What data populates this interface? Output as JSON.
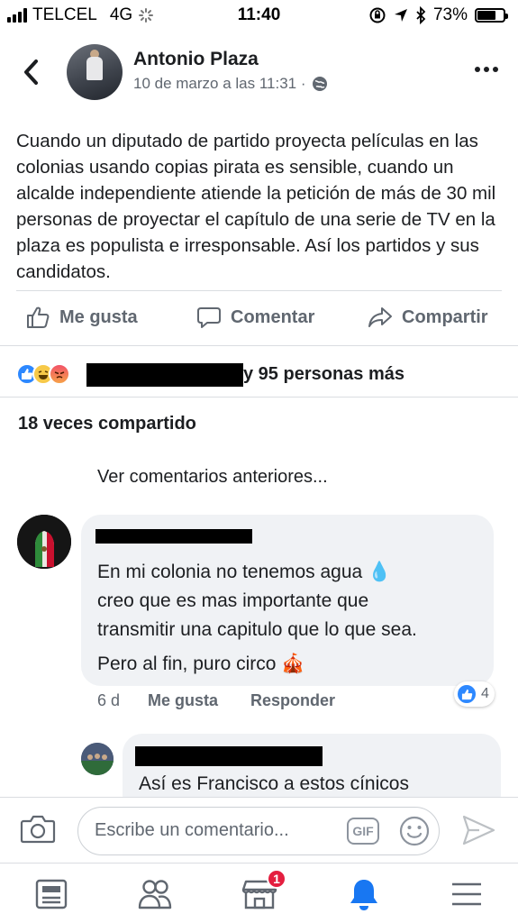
{
  "status_bar": {
    "carrier": "TELCEL",
    "network": "4G",
    "time": "11:40",
    "battery_percent": "73%",
    "battery_level": 0.73
  },
  "post": {
    "author": "Antonio Plaza",
    "date": "10 de marzo a las 11:31 ·",
    "privacy_icon": "globe-icon",
    "text": "Cuando un diputado de partido proyecta películas en las colonias usando copias pirata es sensible, cuando un alcalde independiente atiende la petición de más de 30 mil personas de proyectar el capítulo de una serie de TV en la plaza es populista e irresponsable. Así los partidos y sus candidatos."
  },
  "actions": {
    "like": "Me gusta",
    "comment": "Comentar",
    "share": "Compartir"
  },
  "reactions": {
    "others_text": "y 95 personas más",
    "icons": [
      "like-reaction-icon",
      "haha-reaction-icon",
      "angry-reaction-icon"
    ]
  },
  "shares": "18 veces compartido",
  "view_previous": "Ver comentarios anteriores...",
  "comments": [
    {
      "text_lines": [
        "En mi colonia no tenemos agua 💧",
        "creo que es mas importante que",
        "transmitir una capitulo que lo que sea."
      ],
      "text_line4": "Pero al fin, puro circo 🎪",
      "time": "6 d",
      "like_label": "Me gusta",
      "reply_label": "Responder",
      "like_count": "4"
    },
    {
      "text": "Así es Francisco a estos cínicos"
    }
  ],
  "composer": {
    "placeholder": "Escribe un comentario...",
    "gif_label": "GIF"
  },
  "tabbar": {
    "marketplace_badge": "1"
  },
  "colors": {
    "facebook_blue": "#1877f2",
    "like_blue": "#2d88ff",
    "badge_red": "#e41e3f",
    "muted_text": "#606770"
  }
}
